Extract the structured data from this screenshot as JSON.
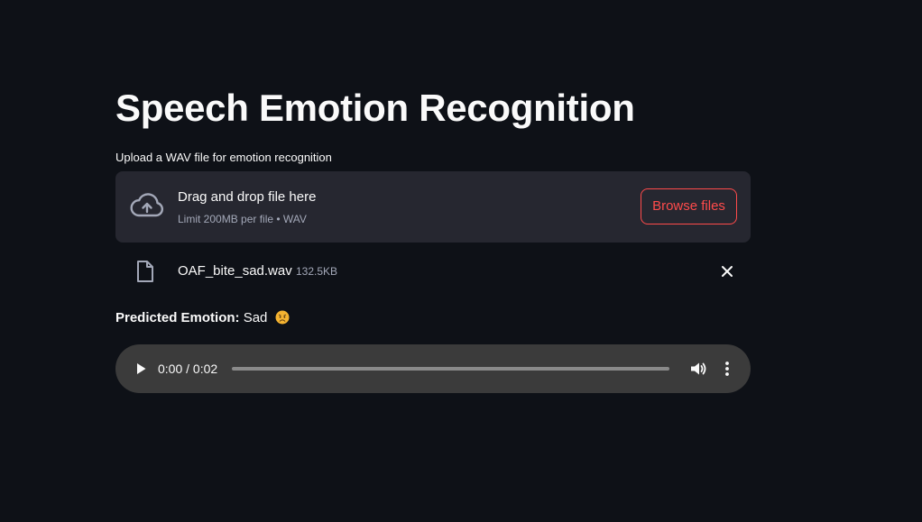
{
  "header": {
    "title": "Speech Emotion Recognition"
  },
  "uploader": {
    "label": "Upload a WAV file for emotion recognition",
    "dropzone_instruction": "Drag and drop file here",
    "dropzone_limit": "Limit 200MB per file • WAV",
    "browse_label": "Browse files",
    "icon": "cloud-upload-icon"
  },
  "uploaded_file": {
    "name": "OAF_bite_sad.wav",
    "size": "132.5KB",
    "icon": "file-icon"
  },
  "prediction": {
    "label": "Predicted Emotion:",
    "value": "Sad",
    "emoji": "sad-face-emoji"
  },
  "audio_player": {
    "time_display": "0:00 / 0:02",
    "progress": 0,
    "icons": [
      "play-icon",
      "volume-icon",
      "more-vertical-icon"
    ]
  },
  "colors": {
    "background": "#0e1117",
    "panel": "#262730",
    "accent": "#ff4b4b",
    "text": "#fafafa",
    "muted_text": "#a3a8b8",
    "player_background": "#3b3b3b"
  }
}
